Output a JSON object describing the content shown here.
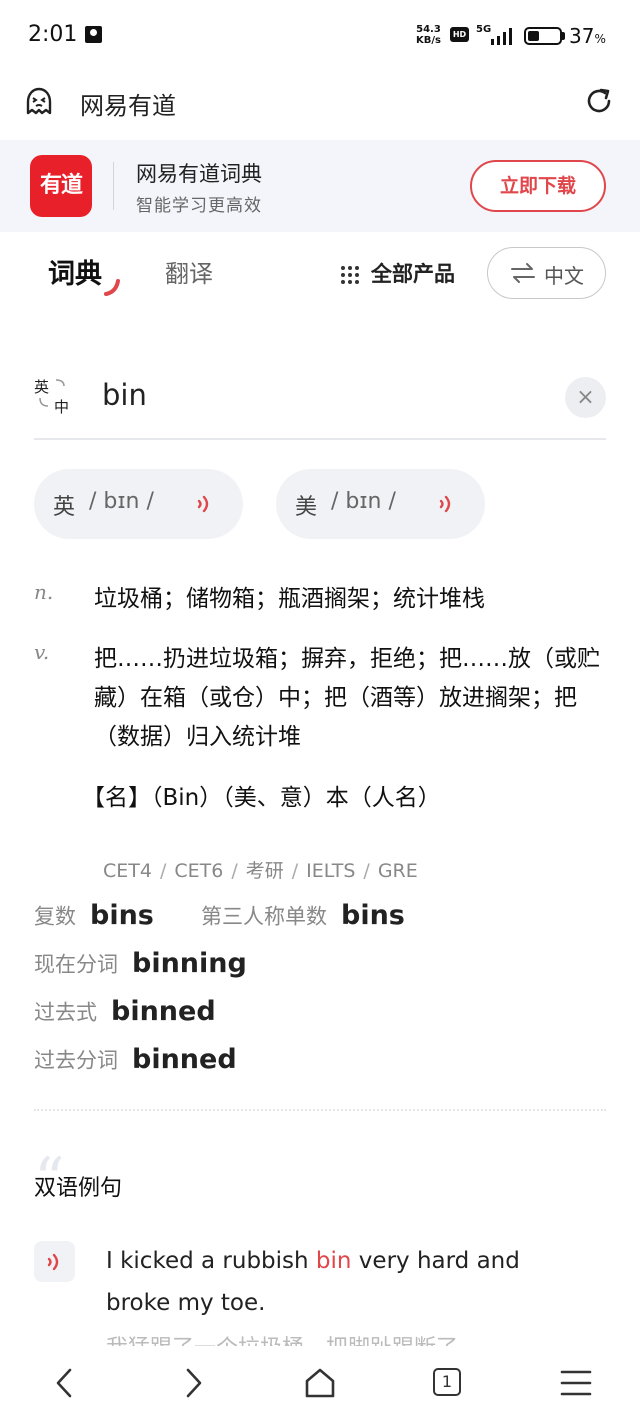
{
  "status_bar": {
    "time": "2:01",
    "net_speed": "54.3",
    "net_unit": "KB/s",
    "hd": "HD",
    "network": "5G",
    "battery_percent": "37",
    "battery_unit": "%",
    "battery_level": 0.37
  },
  "browser": {
    "title": "网易有道"
  },
  "banner": {
    "logo_text": "有道",
    "title": "网易有道词典",
    "subtitle": "智能学习更高效",
    "download_label": "立即下载"
  },
  "tabs": {
    "dict_label": "词典",
    "translate_label": "翻译",
    "all_products_label": "全部产品",
    "language_label": "中文"
  },
  "search": {
    "lang_toggle_en": "英",
    "lang_toggle_zh": "中",
    "query": "bin",
    "clear_icon": "×"
  },
  "pronunciation": {
    "uk_label": "英",
    "uk_ipa": "/ bɪn /",
    "us_label": "美",
    "us_ipa": "/ bɪn /"
  },
  "definitions": [
    {
      "pos": "n.",
      "meaning": "垃圾桶；储物箱；瓶酒搁架；统计堆栈"
    },
    {
      "pos": "v.",
      "meaning": "把……扔进垃圾箱；摒弃，拒绝；把……放（或贮藏）在箱（或仓）中；把（酒等）放进搁架；把（数据）归入统计堆"
    }
  ],
  "name_definition": "【名】（Bin）（美、意）本（人名）",
  "levels": [
    "CET4",
    "CET6",
    "考研",
    "IELTS",
    "GRE"
  ],
  "word_forms": [
    {
      "label": "复数",
      "value": "bins"
    },
    {
      "label": "第三人称单数",
      "value": "bins"
    },
    {
      "label": "现在分词",
      "value": "binning"
    },
    {
      "label": "过去式",
      "value": "binned"
    },
    {
      "label": "过去分词",
      "value": "binned"
    }
  ],
  "examples_section": {
    "title": "双语例句",
    "example_before": "I kicked a rubbish ",
    "example_highlight": "bin",
    "example_after": " very hard and broke my toe.",
    "translation_partial": "我猛踢了一个垃圾桶，把脚趾踢断了。"
  },
  "bottom_nav": {
    "tab_count": "1"
  },
  "colors": {
    "accent": "#e0474b",
    "brand_red": "#e8202a",
    "banner_bg": "#f3f5fa",
    "pill_bg": "#f1f2f5"
  },
  "icons": [
    "person-icon",
    "signal-icon",
    "battery-icon",
    "ghost-icon",
    "reload-icon",
    "grid-icon",
    "swap-icon",
    "clear-icon",
    "speaker-icon",
    "back-icon",
    "forward-icon",
    "home-icon",
    "tabs-icon",
    "menu-icon"
  ]
}
